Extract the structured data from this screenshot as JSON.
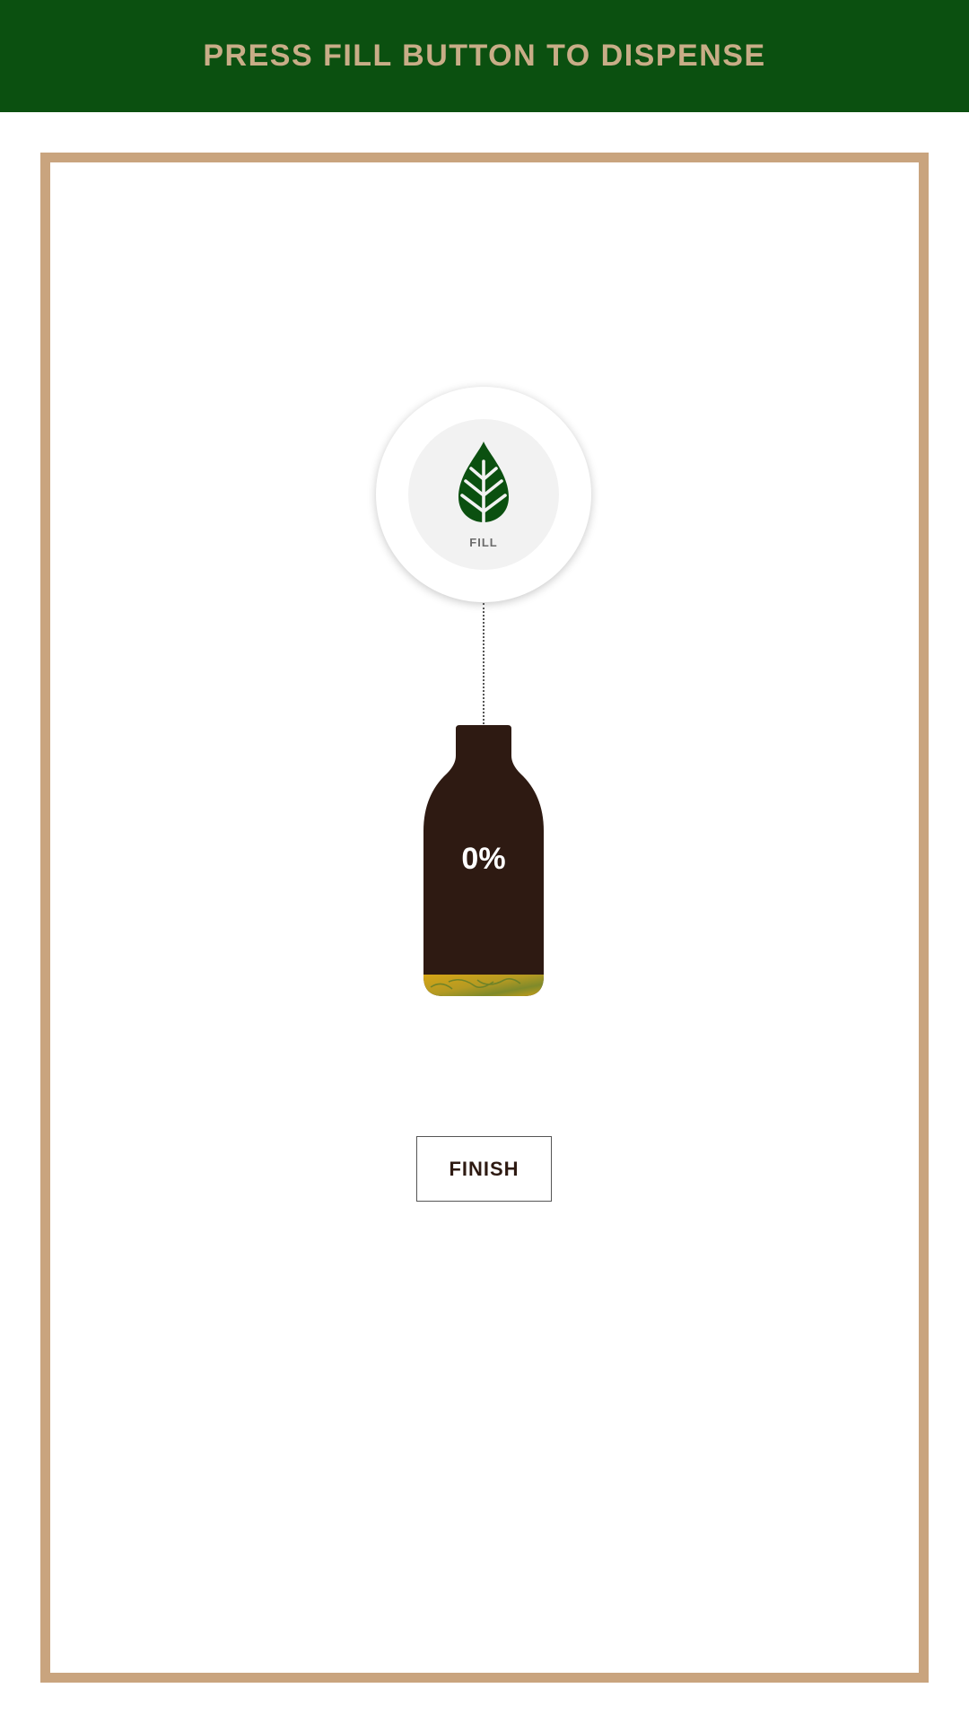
{
  "header": {
    "title": "PRESS FILL BUTTON TO DISPENSE"
  },
  "fill_button": {
    "label": "FILL",
    "icon": "leaf-icon"
  },
  "bottle": {
    "percent_label": "0%",
    "fill_level": 0,
    "icon": "bottle-icon"
  },
  "finish_button": {
    "label": "FINISH"
  },
  "colors": {
    "header_bg": "#0b5010",
    "header_text": "#c8ad87",
    "frame_border": "#c9a47e",
    "leaf": "#0b5010",
    "bottle": "#2e1a12",
    "liquid": "#d7a516"
  }
}
